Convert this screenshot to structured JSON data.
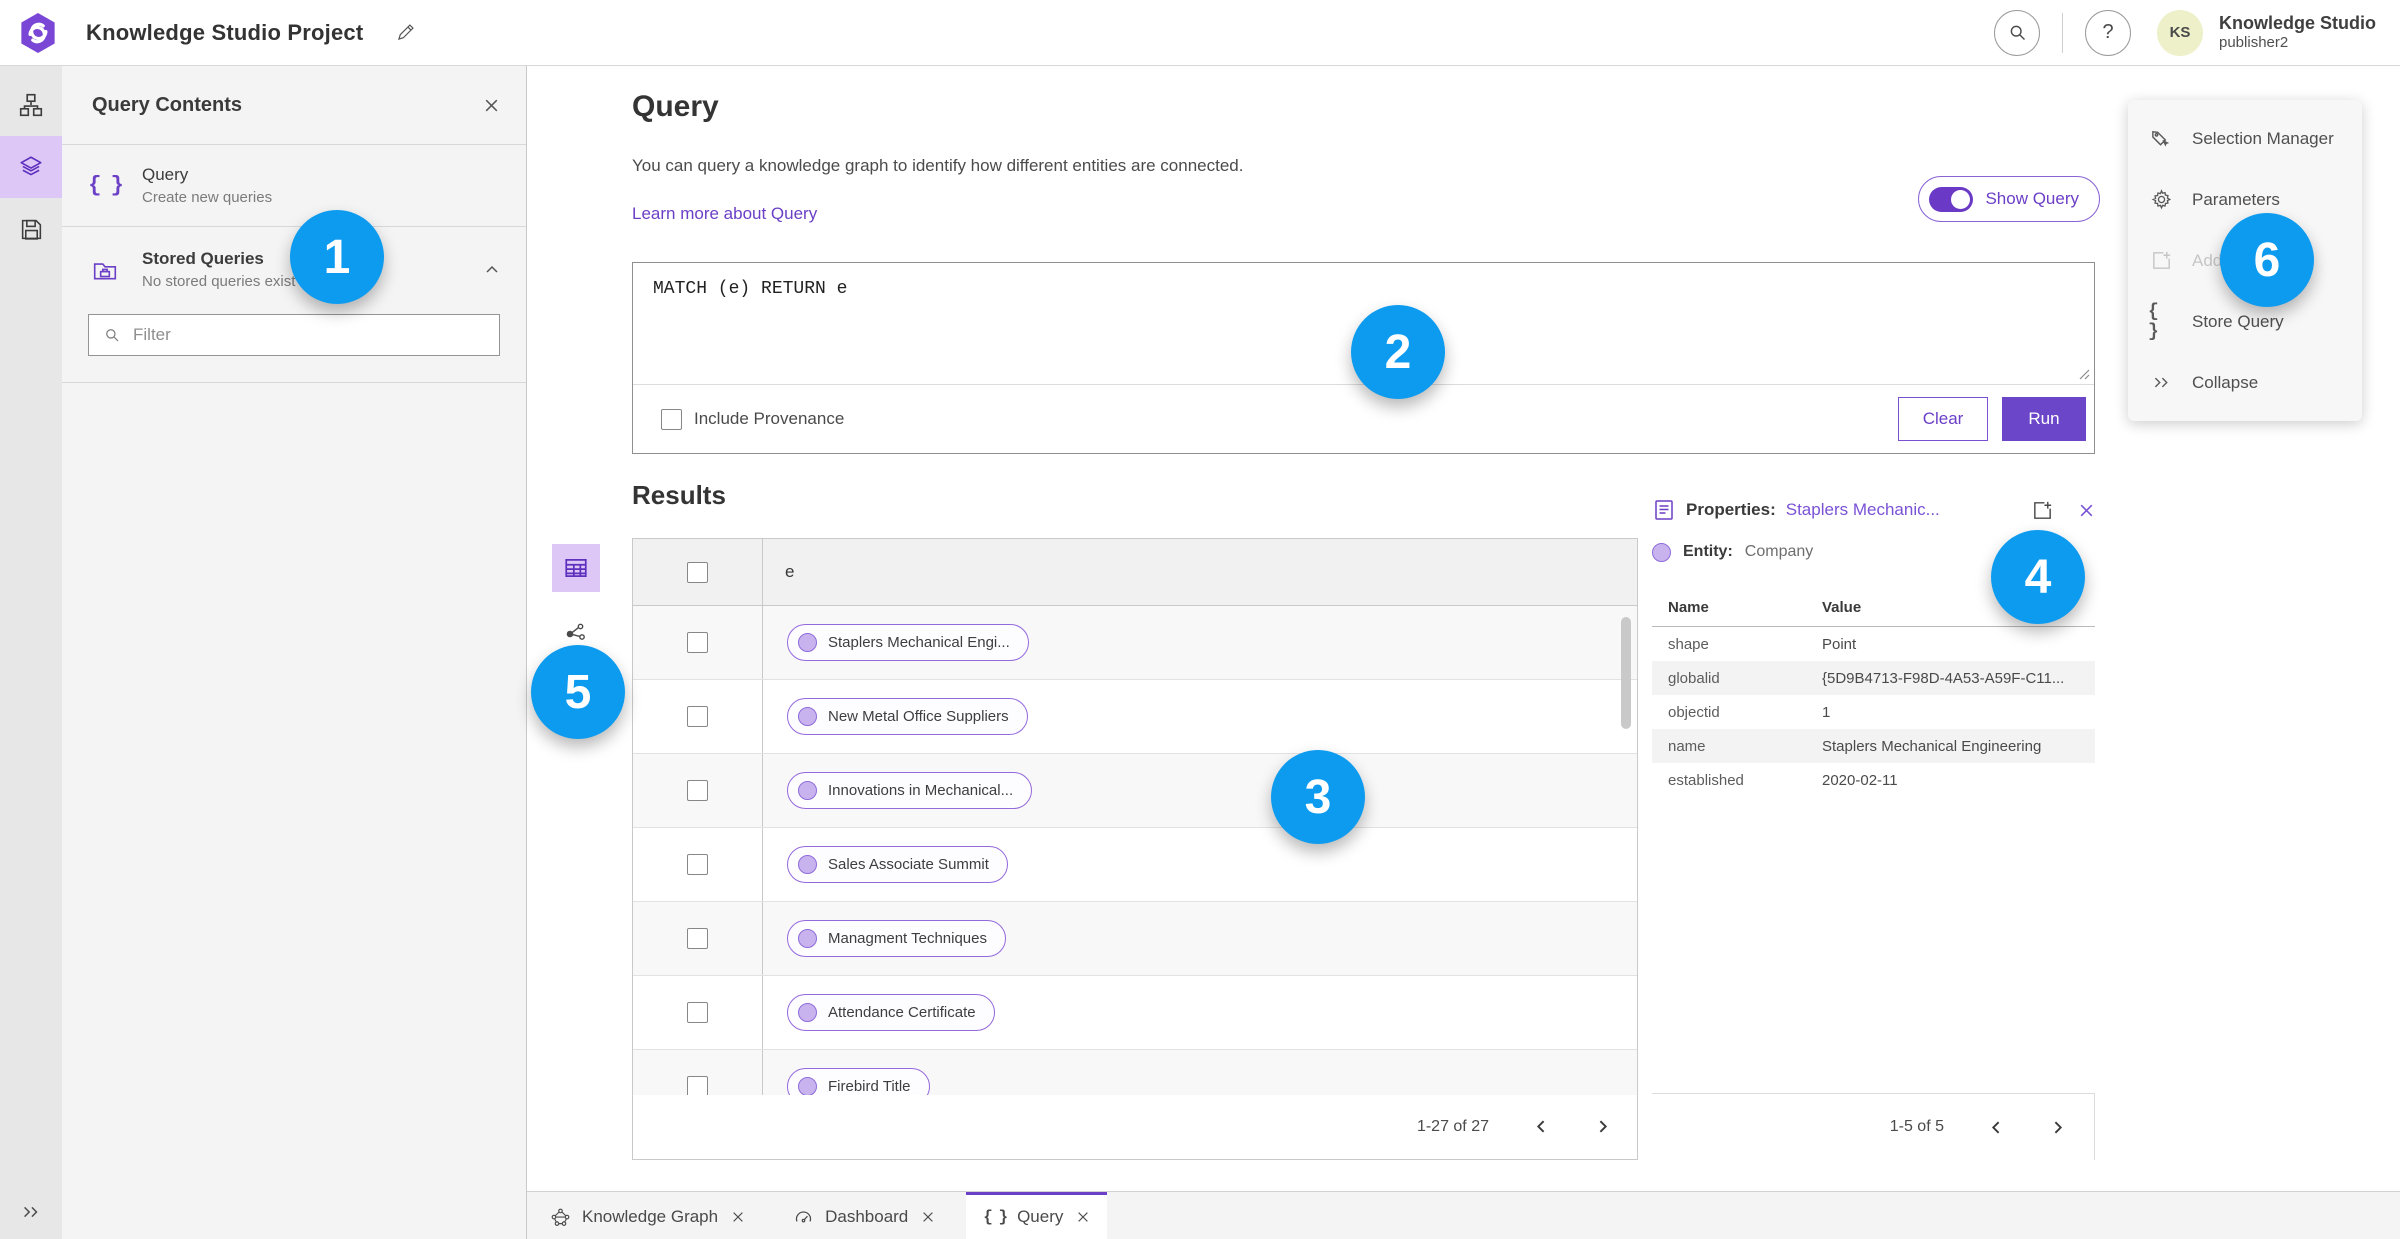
{
  "header": {
    "title": "Knowledge Studio Project",
    "help_glyph": "?",
    "avatar_initials": "KS",
    "user_name": "Knowledge Studio",
    "user_role": "publisher2"
  },
  "contents_panel": {
    "title": "Query Contents",
    "query_item": {
      "label": "Query",
      "sublabel": "Create new queries"
    },
    "stored_item": {
      "label": "Stored Queries",
      "sublabel": "No stored queries exist"
    },
    "filter_placeholder": "Filter"
  },
  "query_section": {
    "title": "Query",
    "description": "You can query a knowledge graph to identify how different entities are connected.",
    "learn_more": "Learn more about Query",
    "show_query_label": "Show Query",
    "query_text": "MATCH (e) RETURN e",
    "include_provenance_label": "Include Provenance",
    "clear_label": "Clear",
    "run_label": "Run"
  },
  "results": {
    "title": "Results",
    "column_header": "e",
    "rows": [
      "Staplers Mechanical Engi...",
      "New Metal Office Suppliers",
      "Innovations in Mechanical...",
      "Sales Associate Summit",
      "Managment Techniques",
      "Attendance Certificate",
      "Firebird Title"
    ],
    "pagination": "1-27 of 27"
  },
  "properties": {
    "title_label": "Properties:",
    "title_link": "Staplers Mechanic...",
    "entity_label": "Entity:",
    "entity_value": "Company",
    "columns": {
      "name": "Name",
      "value": "Value"
    },
    "rows": [
      [
        "shape",
        "Point"
      ],
      [
        "globalid",
        "{5D9B4713-F98D-4A53-A59F-C11..."
      ],
      [
        "objectid",
        "1"
      ],
      [
        "name",
        "Staplers Mechanical Engineering"
      ],
      [
        "established",
        "2020-02-11"
      ]
    ],
    "pagination": "1-5 of 5"
  },
  "side_menu": {
    "items": [
      {
        "label": "Selection Manager"
      },
      {
        "label": "Parameters"
      },
      {
        "label": "Add",
        "disabled": true
      },
      {
        "label": "Store Query"
      },
      {
        "label": "Collapse"
      }
    ]
  },
  "tabs": [
    {
      "label": "Knowledge Graph"
    },
    {
      "label": "Dashboard"
    },
    {
      "label": "Query",
      "active": true
    }
  ],
  "annotations": [
    "1",
    "2",
    "3",
    "4",
    "5",
    "6"
  ],
  "icons": {
    "braces": "{ }"
  },
  "colors": {
    "accent_purple": "#6b3fc6",
    "annotation_blue": "#0d9bf0",
    "selected_light_purple": "#dcc7f6"
  }
}
